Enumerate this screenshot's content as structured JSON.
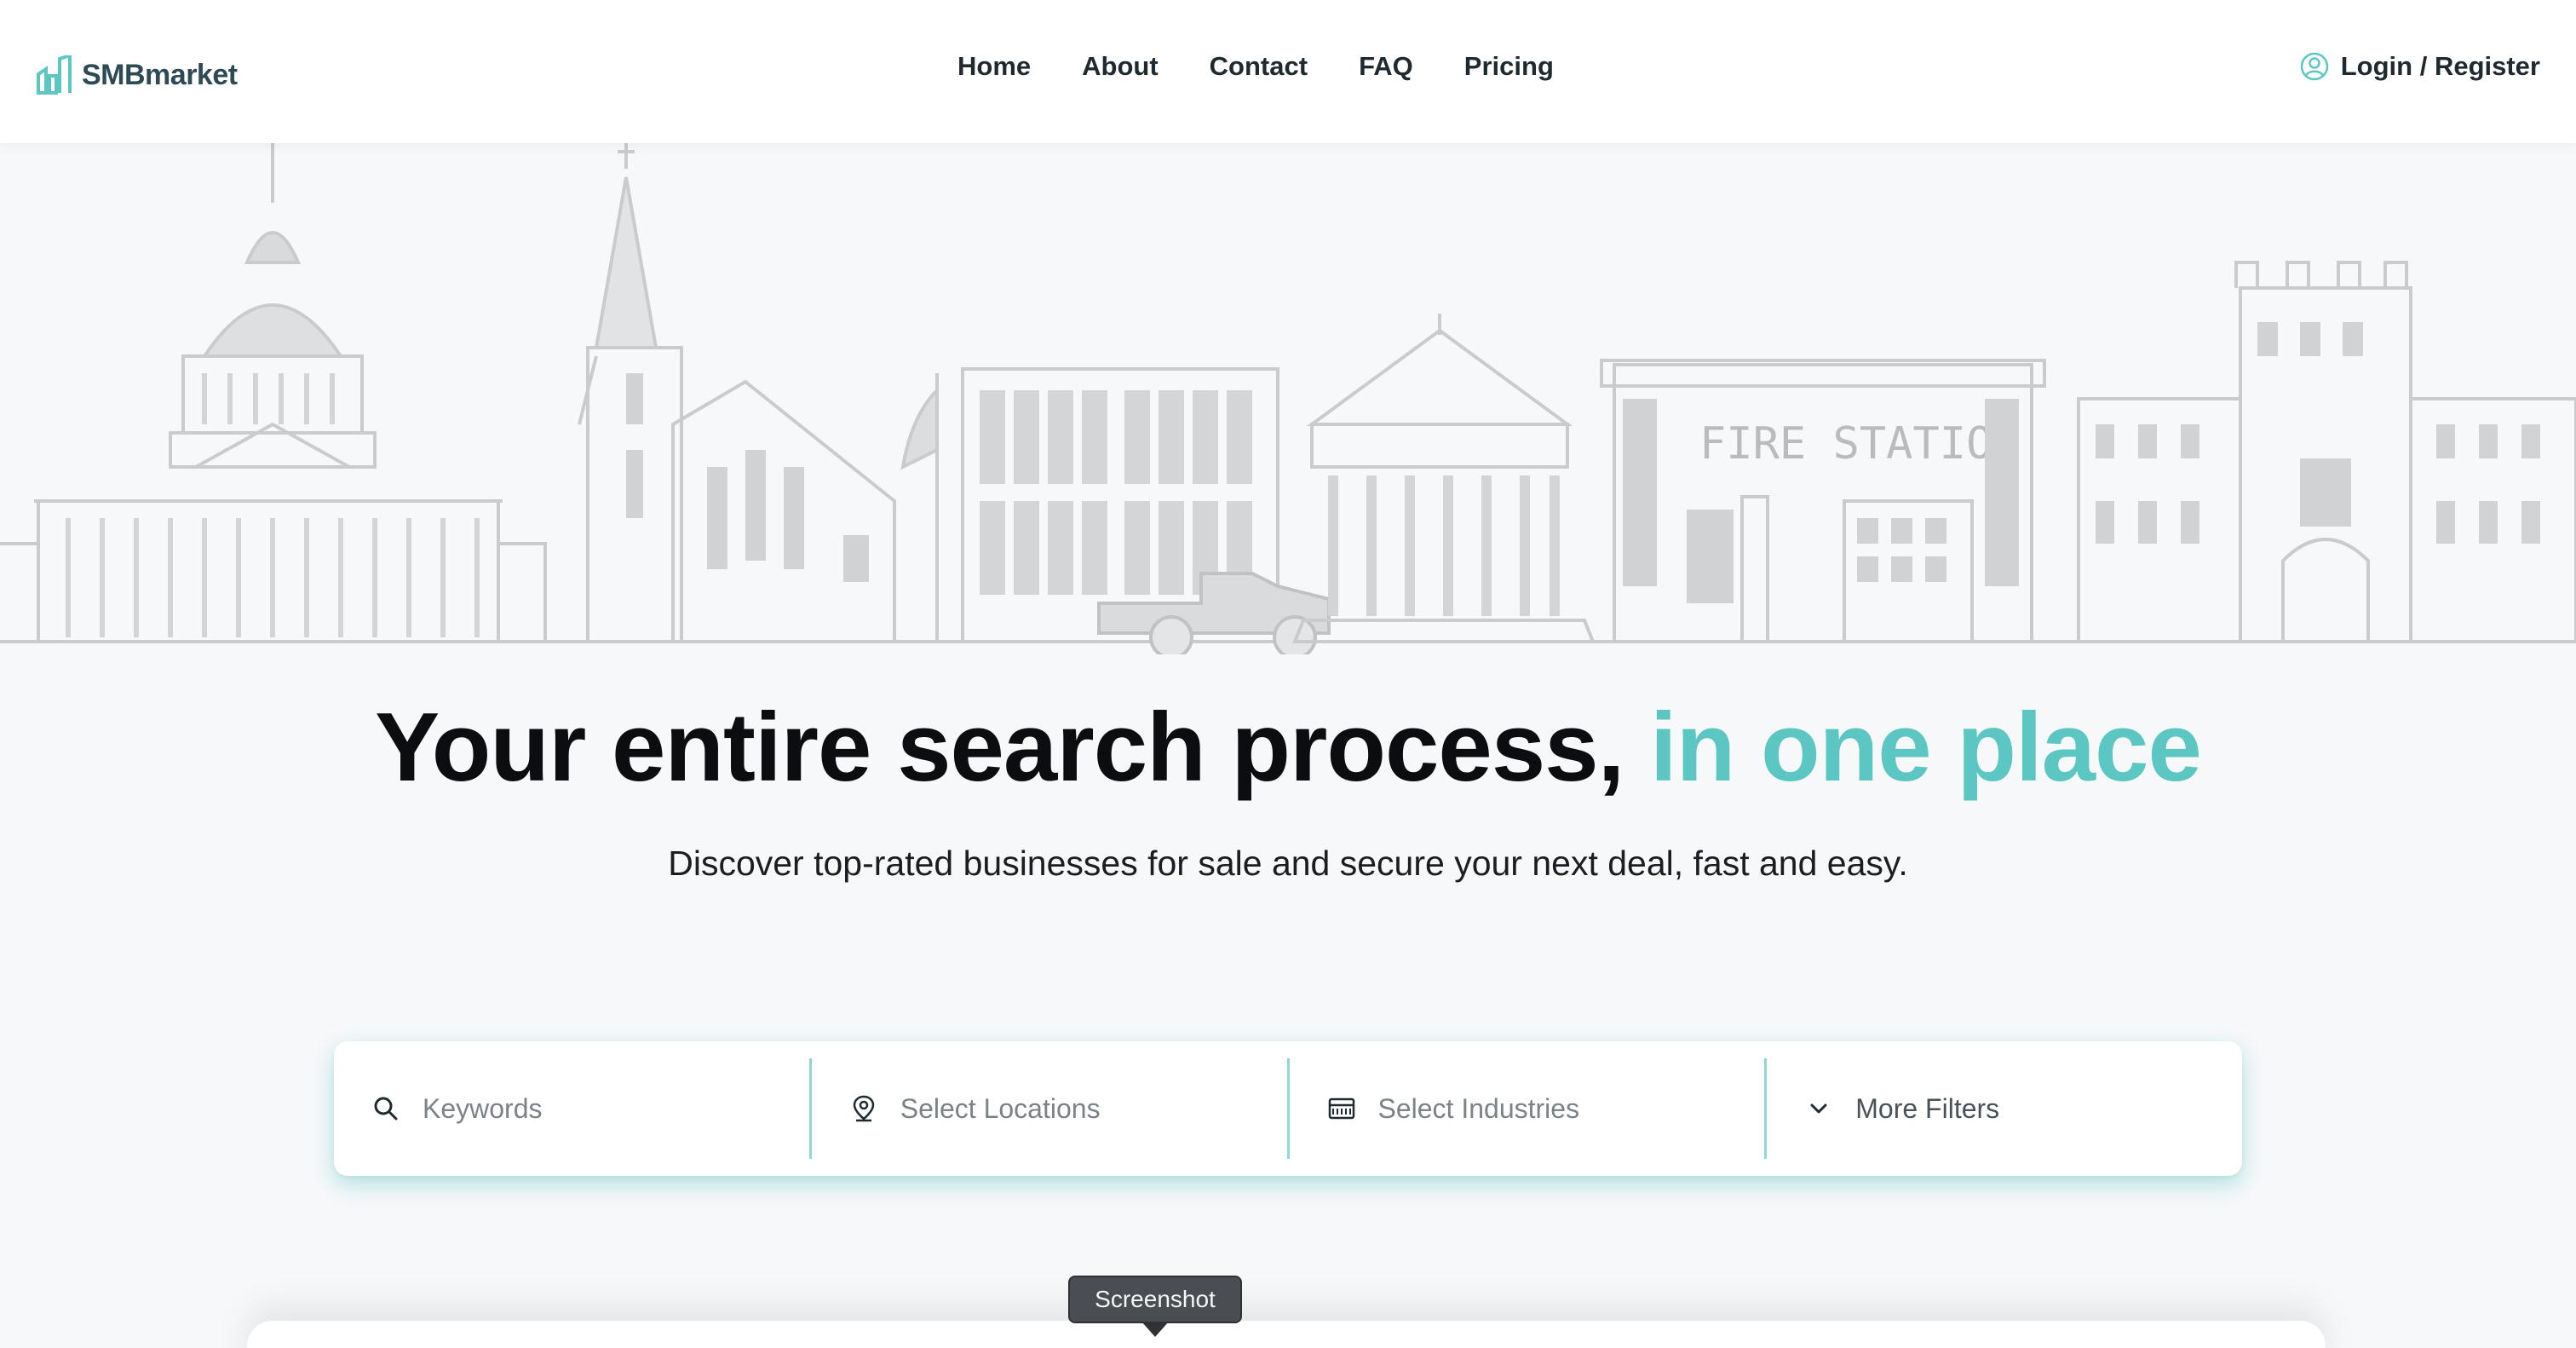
{
  "brand": {
    "name": "SMBmarket",
    "accent_color": "#5cc6c2",
    "logo_icon": "bar-chart-building-icon"
  },
  "nav": {
    "links": [
      "Home",
      "About",
      "Contact",
      "FAQ",
      "Pricing"
    ],
    "login_label": "Login / Register",
    "login_icon": "user-circle-icon"
  },
  "hero": {
    "skyline_sign": "FIRE STATION",
    "headline_main": "Your entire search process,",
    "headline_accent": "in one place",
    "subheadline": "Discover top-rated businesses for sale and secure your next deal, fast and easy."
  },
  "search": {
    "keywords_placeholder": "Keywords",
    "keywords_icon": "search-icon",
    "locations_placeholder": "Select Locations",
    "locations_icon": "map-pin-icon",
    "industries_placeholder": "Select Industries",
    "industries_icon": "storefront-icon",
    "more_filters_label": "More Filters",
    "more_filters_icon": "chevron-down-icon"
  },
  "tooltip": {
    "label": "Screenshot"
  }
}
